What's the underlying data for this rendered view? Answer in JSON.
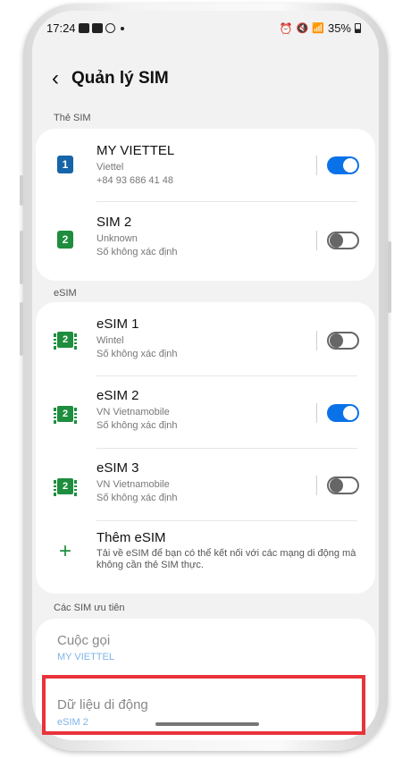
{
  "status_bar": {
    "time": "17:24",
    "battery": "35%"
  },
  "header": {
    "back_icon": "‹",
    "title": "Quản lý SIM"
  },
  "sim_section": {
    "label": "Thẻ SIM",
    "items": [
      {
        "badge": "1",
        "badge_color": "#1565a8",
        "name": "MY VIETTEL",
        "carrier": "Viettel",
        "number": "+84 93 686 41 48",
        "enabled": true
      },
      {
        "badge": "2",
        "badge_color": "#1e8e3e",
        "name": "SIM 2",
        "carrier": "Unknown",
        "number": "Số không xác định",
        "enabled": false
      }
    ]
  },
  "esim_section": {
    "label": "eSIM",
    "items": [
      {
        "badge": "2",
        "name": "eSIM 1",
        "carrier": "Wintel",
        "number": "Số không xác định",
        "enabled": false
      },
      {
        "badge": "2",
        "name": "eSIM 2",
        "carrier": "VN Vietnamobile",
        "number": "Số không xác định",
        "enabled": true
      },
      {
        "badge": "2",
        "name": "eSIM 3",
        "carrier": "VN Vietnamobile",
        "number": "Số không xác định",
        "enabled": false
      }
    ],
    "add": {
      "icon": "+",
      "title": "Thêm eSIM",
      "description": "Tải về eSIM để bạn có thể kết nối với các mạng di động mà không cần thẻ SIM thực."
    }
  },
  "preferred_section": {
    "label": "Các SIM ưu tiên",
    "calls": {
      "title": "Cuộc gọi",
      "value": "MY VIETTEL"
    },
    "mobile_data": {
      "title": "Dữ liệu di động",
      "value": "eSIM 2"
    }
  },
  "colors": {
    "accent": "#0a72e8",
    "highlight": "#e8333a",
    "esim_green": "#1e8e3e"
  }
}
